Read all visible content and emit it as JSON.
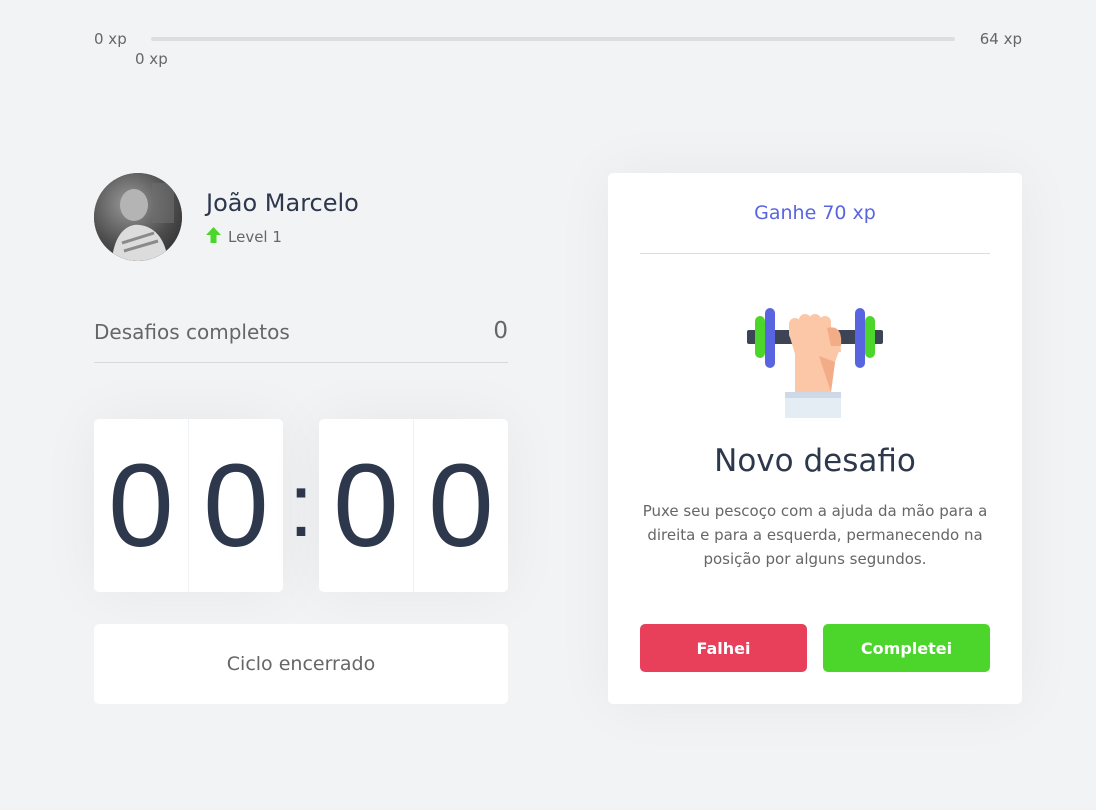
{
  "experience": {
    "min_label": "0 xp",
    "max_label": "64 xp",
    "current_label": "0 xp",
    "current_xp": 0,
    "next_level_xp": 64,
    "bar_color": "#4cd62b"
  },
  "profile": {
    "name": "João Marcelo",
    "level_label": "Level 1",
    "level_icon": "level-up-arrow-icon"
  },
  "completed_challenges": {
    "label": "Desafios completos",
    "value": "0"
  },
  "countdown": {
    "minute_left": "0",
    "minute_right": "0",
    "separator": ":",
    "second_left": "0",
    "second_right": "0"
  },
  "cycle_button": {
    "label": "Ciclo encerrado"
  },
  "challenge": {
    "header": "Ganhe 70 xp",
    "icon": "dumbbell-hand-icon",
    "title": "Novo desafio",
    "description": "Puxe seu pescoço com a ajuda da mão para a direita e para a esquerda, permanecendo na posição por alguns segundos.",
    "fail_label": "Falhei",
    "success_label": "Completei"
  },
  "colors": {
    "background": "#f2f3f5",
    "text": "#666666",
    "title": "#2e384d",
    "blue": "#5965e0",
    "green": "#4cd62b",
    "red": "#e83f5b"
  }
}
